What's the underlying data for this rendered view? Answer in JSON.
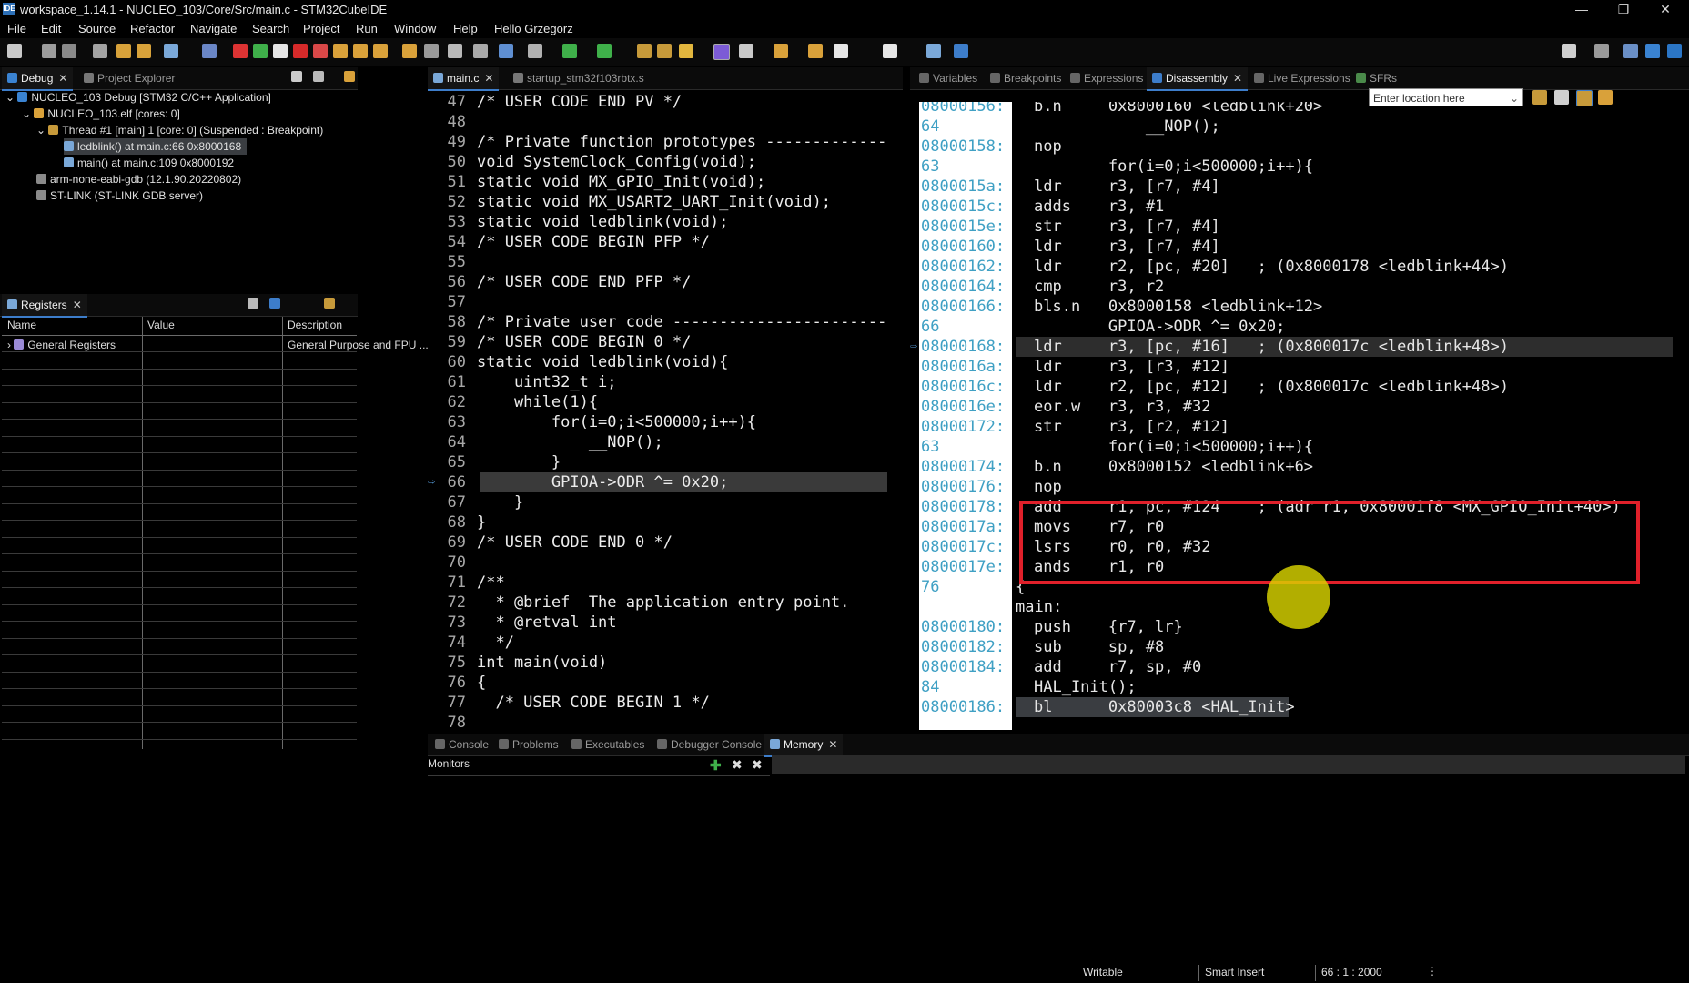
{
  "window": {
    "title": "workspace_1.14.1 - NUCLEO_103/Core/Src/main.c - STM32CubeIDE",
    "app_icon": "IDE",
    "controls": [
      "—",
      "❐",
      "✕"
    ]
  },
  "menu": [
    "File",
    "Edit",
    "Source",
    "Refactor",
    "Navigate",
    "Search",
    "Project",
    "Run",
    "Window",
    "Help",
    "Hello Grzegorz"
  ],
  "debug_view": {
    "tabs": [
      "Debug",
      "Project Explorer"
    ],
    "tree": [
      {
        "label": "NUCLEO_103 Debug [STM32 C/C++ Application]",
        "icon": "launch-config-icon"
      },
      {
        "label": "NUCLEO_103.elf [cores: 0]",
        "icon": "process-icon"
      },
      {
        "label": "Thread #1 [main] 1 [core: 0] (Suspended : Breakpoint)",
        "icon": "thread-icon"
      },
      {
        "label": "ledblink() at main.c:66 0x8000168",
        "icon": "stack-frame-icon"
      },
      {
        "label": "main() at main.c:109 0x8000192",
        "icon": "stack-frame-icon"
      },
      {
        "label": "arm-none-eabi-gdb (12.1.90.20220802)",
        "icon": "gdb-icon"
      },
      {
        "label": "ST-LINK (ST-LINK GDB server)",
        "icon": "stlink-icon"
      }
    ]
  },
  "registers_view": {
    "tab": "Registers",
    "columns": [
      "Name",
      "Value",
      "Description"
    ],
    "rows": [
      {
        "name": "General Registers",
        "value": "",
        "description": "General Purpose and FPU ..."
      }
    ]
  },
  "editor": {
    "tabs": [
      "main.c",
      "startup_stm32f103rbtx.s"
    ],
    "current_line": "66",
    "lines": [
      {
        "n": "47",
        "text": "/* USER CODE END PV */"
      },
      {
        "n": "48",
        "text": ""
      },
      {
        "n": "49",
        "text": "/* Private function prototypes -----------------------------------------------*/"
      },
      {
        "n": "50",
        "text": "void SystemClock_Config(void);"
      },
      {
        "n": "51",
        "text": "static void MX_GPIO_Init(void);"
      },
      {
        "n": "52",
        "text": "static void MX_USART2_UART_Init(void);"
      },
      {
        "n": "53",
        "text": "static void ledblink(void);"
      },
      {
        "n": "54",
        "text": "/* USER CODE BEGIN PFP */"
      },
      {
        "n": "55",
        "text": ""
      },
      {
        "n": "56",
        "text": "/* USER CODE END PFP */"
      },
      {
        "n": "57",
        "text": ""
      },
      {
        "n": "58",
        "text": "/* Private user code ---------------------------------------------------------*/"
      },
      {
        "n": "59",
        "text": "/* USER CODE BEGIN 0 */"
      },
      {
        "n": "60",
        "text": "static void ledblink(void){"
      },
      {
        "n": "61",
        "text": "    uint32_t i;"
      },
      {
        "n": "62",
        "text": "    while(1){"
      },
      {
        "n": "63",
        "text": "        for(i=0;i<500000;i++){"
      },
      {
        "n": "64",
        "text": "            __NOP();"
      },
      {
        "n": "65",
        "text": "        }"
      },
      {
        "n": "66",
        "text": "        GPIOA->ODR ^= 0x20;"
      },
      {
        "n": "67",
        "text": "    }"
      },
      {
        "n": "68",
        "text": "}"
      },
      {
        "n": "69",
        "text": "/* USER CODE END 0 */"
      },
      {
        "n": "70",
        "text": ""
      },
      {
        "n": "71",
        "text": "/**"
      },
      {
        "n": "72",
        "text": "  * @brief  The application entry point."
      },
      {
        "n": "73",
        "text": "  * @retval int"
      },
      {
        "n": "74",
        "text": "  */"
      },
      {
        "n": "75",
        "text": "int main(void)"
      },
      {
        "n": "76",
        "text": "{"
      },
      {
        "n": "77",
        "text": "  /* USER CODE BEGIN 1 */"
      },
      {
        "n": "78",
        "text": ""
      }
    ]
  },
  "disassembly_view": {
    "tabs": [
      "Variables",
      "Breakpoints",
      "Expressions",
      "Disassembly",
      "Live Expressions",
      "SFRs"
    ],
    "location_placeholder": "Enter location here",
    "rows": [
      {
        "addr": "08000156:",
        "text": "b.n     0x8000160 <ledblink+20>",
        "kind": "asm"
      },
      {
        "addr": "64",
        "text": "            __NOP();",
        "kind": "src"
      },
      {
        "addr": "08000158:",
        "text": "nop",
        "kind": "asm"
      },
      {
        "addr": "63",
        "text": "        for(i=0;i<500000;i++){",
        "kind": "src"
      },
      {
        "addr": "0800015a:",
        "text": "ldr     r3, [r7, #4]",
        "kind": "asm"
      },
      {
        "addr": "0800015c:",
        "text": "adds    r3, #1",
        "kind": "asm"
      },
      {
        "addr": "0800015e:",
        "text": "str     r3, [r7, #4]",
        "kind": "asm"
      },
      {
        "addr": "08000160:",
        "text": "ldr     r3, [r7, #4]",
        "kind": "asm"
      },
      {
        "addr": "08000162:",
        "text": "ldr     r2, [pc, #20]   ; (0x8000178 <ledblink+44>)",
        "kind": "asm"
      },
      {
        "addr": "08000164:",
        "text": "cmp     r3, r2",
        "kind": "asm"
      },
      {
        "addr": "08000166:",
        "text": "bls.n   0x8000158 <ledblink+12>",
        "kind": "asm"
      },
      {
        "addr": "66",
        "text": "        GPIOA->ODR ^= 0x20;",
        "kind": "src"
      },
      {
        "addr": "08000168:",
        "text": "ldr     r3, [pc, #16]   ; (0x800017c <ledblink+48>)",
        "kind": "asm-current"
      },
      {
        "addr": "0800016a:",
        "text": "ldr     r3, [r3, #12]",
        "kind": "asm"
      },
      {
        "addr": "0800016c:",
        "text": "ldr     r2, [pc, #12]   ; (0x800017c <ledblink+48>)",
        "kind": "asm"
      },
      {
        "addr": "0800016e:",
        "text": "eor.w   r3, r3, #32",
        "kind": "asm"
      },
      {
        "addr": "08000172:",
        "text": "str     r3, [r2, #12]",
        "kind": "asm"
      },
      {
        "addr": "63",
        "text": "        for(i=0;i<500000;i++){",
        "kind": "src"
      },
      {
        "addr": "08000174:",
        "text": "b.n     0x8000152 <ledblink+6>",
        "kind": "asm"
      },
      {
        "addr": "08000176:",
        "text": "nop",
        "kind": "asm"
      },
      {
        "addr": "08000178:",
        "text": "add     r1, pc, #124    ; (adr r1, 0x80001f8 <MX_GPIO_Init+40>)",
        "kind": "asm"
      },
      {
        "addr": "0800017a:",
        "text": "movs    r7, r0",
        "kind": "asm"
      },
      {
        "addr": "0800017c:",
        "text": "lsrs    r0, r0, #32",
        "kind": "asm"
      },
      {
        "addr": "0800017e:",
        "text": "ands    r1, r0",
        "kind": "asm"
      },
      {
        "addr": "76",
        "text": "{",
        "kind": "label"
      },
      {
        "addr": "",
        "text": "main:",
        "kind": "label"
      },
      {
        "addr": "08000180:",
        "text": "push    {r7, lr}",
        "kind": "asm"
      },
      {
        "addr": "08000182:",
        "text": "sub     sp, #8",
        "kind": "asm"
      },
      {
        "addr": "08000184:",
        "text": "add     r7, sp, #0",
        "kind": "asm"
      },
      {
        "addr": "84",
        "text": "HAL_Init();",
        "kind": "src"
      },
      {
        "addr": "08000186:",
        "text": "bl      0x80003c8 <HAL_Init>",
        "kind": "asm-sel"
      }
    ]
  },
  "bottom_view": {
    "tabs": [
      "Console",
      "Problems",
      "Executables",
      "Debugger Console",
      "Memory"
    ],
    "monitors_label": "Monitors"
  },
  "statusbar": {
    "writable": "Writable",
    "insert_mode": "Smart Insert",
    "position": "66 : 1 : 2000"
  },
  "colors": {
    "annotation_box": "#e0202a",
    "cursor_highlight": "#d9d400",
    "address": "#3fa0c4",
    "comment": "#79c46b"
  }
}
